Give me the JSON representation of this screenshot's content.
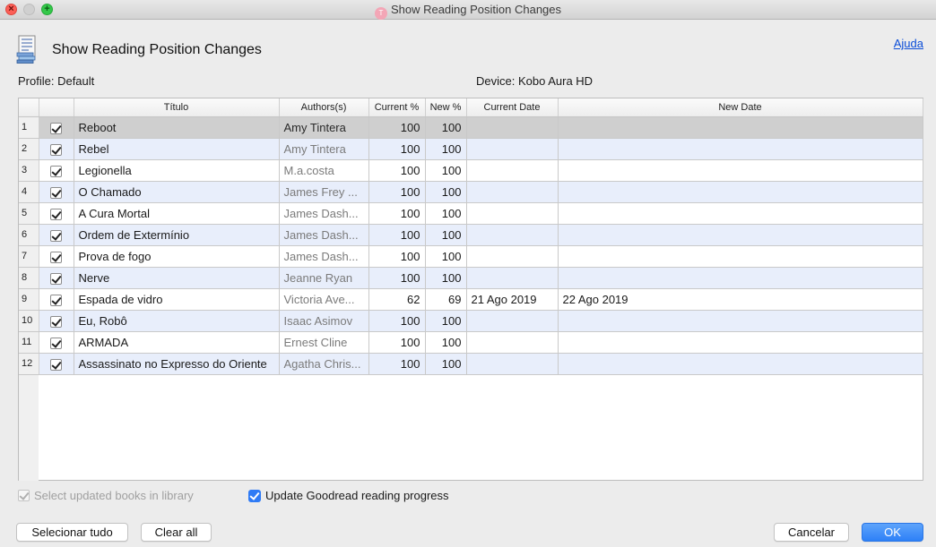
{
  "window": {
    "title": "Show Reading Position Changes",
    "app_icon_text": "T"
  },
  "header": {
    "title": "Show Reading Position Changes",
    "help_link": "Ajuda"
  },
  "info": {
    "profile": "Profile: Default",
    "device": "Device: Kobo Aura HD"
  },
  "table": {
    "columns": [
      "Título",
      "Authors(s)",
      "Current %",
      "New %",
      "Current Date",
      "New Date"
    ],
    "rows": [
      {
        "num": "1",
        "title": "Reboot",
        "author": "Amy Tintera",
        "current": "100",
        "new": "100",
        "current_date": "",
        "new_date": ""
      },
      {
        "num": "2",
        "title": "Rebel",
        "author": "Amy Tintera",
        "current": "100",
        "new": "100",
        "current_date": "",
        "new_date": ""
      },
      {
        "num": "3",
        "title": "Legionella",
        "author": "M.a.costa",
        "current": "100",
        "new": "100",
        "current_date": "",
        "new_date": ""
      },
      {
        "num": "4",
        "title": "O Chamado",
        "author": "James Frey ...",
        "current": "100",
        "new": "100",
        "current_date": "",
        "new_date": ""
      },
      {
        "num": "5",
        "title": "A Cura Mortal",
        "author": "James Dash...",
        "current": "100",
        "new": "100",
        "current_date": "",
        "new_date": ""
      },
      {
        "num": "6",
        "title": "Ordem de Extermínio",
        "author": "James Dash...",
        "current": "100",
        "new": "100",
        "current_date": "",
        "new_date": ""
      },
      {
        "num": "7",
        "title": "Prova de fogo",
        "author": "James Dash...",
        "current": "100",
        "new": "100",
        "current_date": "",
        "new_date": ""
      },
      {
        "num": "8",
        "title": "Nerve",
        "author": "Jeanne Ryan",
        "current": "100",
        "new": "100",
        "current_date": "",
        "new_date": ""
      },
      {
        "num": "9",
        "title": "Espada de vidro",
        "author": "Victoria Ave...",
        "current": "62",
        "new": "69",
        "current_date": "21 Ago 2019",
        "new_date": "22 Ago 2019"
      },
      {
        "num": "10",
        "title": "Eu, Robô",
        "author": "Isaac Asimov",
        "current": "100",
        "new": "100",
        "current_date": "",
        "new_date": ""
      },
      {
        "num": "11",
        "title": "ARMADA",
        "author": "Ernest Cline",
        "current": "100",
        "new": "100",
        "current_date": "",
        "new_date": ""
      },
      {
        "num": "12",
        "title": "Assassinato no Expresso do Oriente",
        "author": "Agatha Chris...",
        "current": "100",
        "new": "100",
        "current_date": "",
        "new_date": ""
      }
    ]
  },
  "options": {
    "select_updated": "Select updated books in library",
    "update_goodreads": "Update Goodread reading progress"
  },
  "buttons": {
    "select_all": "Selecionar tudo",
    "clear_all": "Clear all",
    "cancel": "Cancelar",
    "ok": "OK"
  }
}
